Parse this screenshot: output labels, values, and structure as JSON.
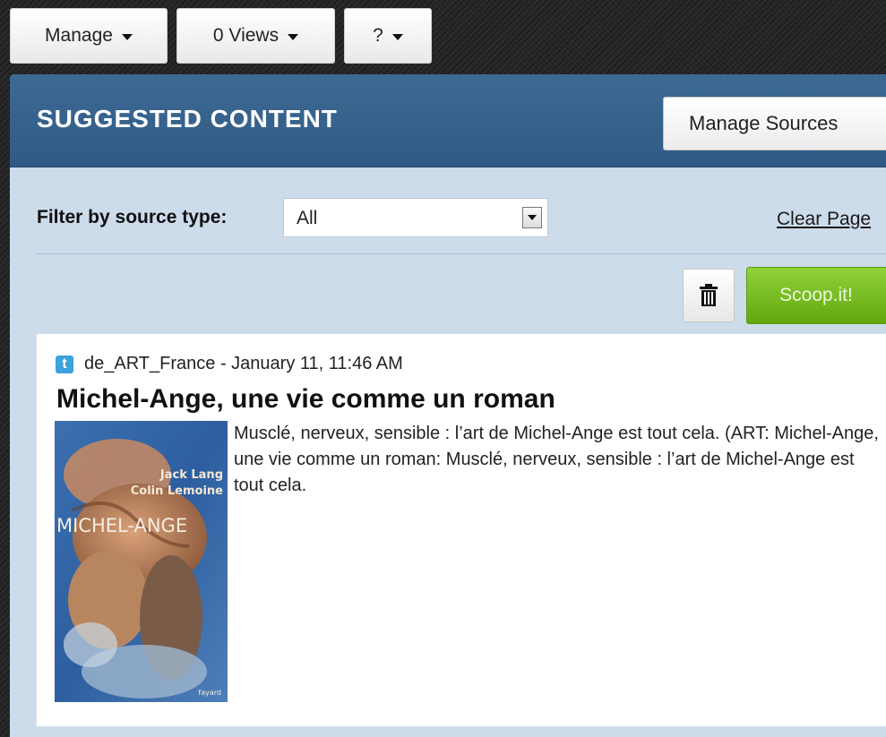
{
  "toolbar": {
    "manage_label": "Manage",
    "views_label": "0 Views",
    "help_label": "?"
  },
  "panel": {
    "title": "SUGGESTED CONTENT",
    "manage_sources_label": "Manage Sources",
    "filter": {
      "label": "Filter by source type:",
      "selected": "All"
    },
    "clear_page_label": "Clear Page",
    "scoop_label": "Scoop.it!",
    "accent_green": "#7cc324",
    "header_blue": "#386590"
  },
  "item": {
    "source_icon": "twitter-icon",
    "source": "de_ART_France",
    "separator": " - ",
    "date": "January 11, 11:46 AM",
    "title": "Michel-Ange, une vie comme un roman",
    "description": "Musclé, nerveux, sensible : l’art de Michel-Ange est tout cela. (ART: Michel-Ange, une vie comme un roman: Musclé, nerveux, sensible : l’art de Michel-Ange est tout cela.",
    "thumbnail": {
      "author1": "Jack Lang",
      "author2": "Colin Lemoine",
      "book_title": "MICHEL-ANGE",
      "publisher": "fayard"
    }
  }
}
